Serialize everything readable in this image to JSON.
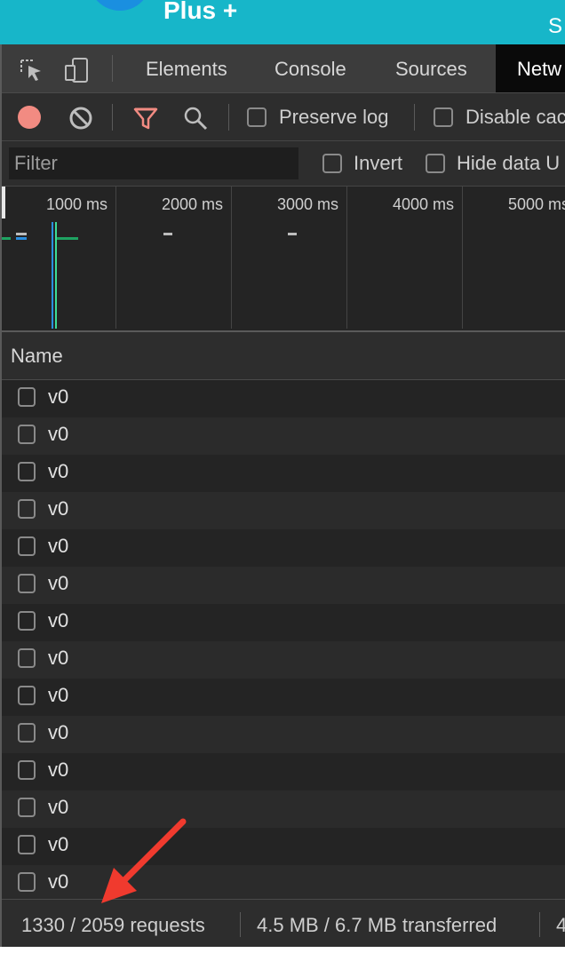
{
  "page_header": {
    "brand": "Plus +",
    "right_fragment": "S"
  },
  "devtools": {
    "tabs": [
      {
        "label": "Elements",
        "active": false
      },
      {
        "label": "Console",
        "active": false
      },
      {
        "label": "Sources",
        "active": false
      },
      {
        "label": "Netw",
        "active": true
      }
    ],
    "toolbar": {
      "preserve_log_label": "Preserve log",
      "disable_cache_label": "Disable cac"
    },
    "filter": {
      "placeholder": "Filter",
      "invert_label": "Invert",
      "hide_data_label": "Hide data U"
    },
    "overview": {
      "ticks": [
        "1000 ms",
        "2000 ms",
        "3000 ms",
        "4000 ms",
        "5000 ms"
      ]
    },
    "table": {
      "name_header": "Name",
      "rows": [
        "v0",
        "v0",
        "v0",
        "v0",
        "v0",
        "v0",
        "v0",
        "v0",
        "v0",
        "v0",
        "v0",
        "v0",
        "v0",
        "v0"
      ]
    },
    "status": {
      "requests": "1330 / 2059 requests",
      "transferred": "4.5 MB / 6.7 MB transferred",
      "trailing": "4"
    },
    "colors": {
      "record": "#f28b82",
      "filter_icon": "#f28b82",
      "annotation_arrow": "#f03a2e",
      "header_bg": "#17b6c9"
    }
  }
}
